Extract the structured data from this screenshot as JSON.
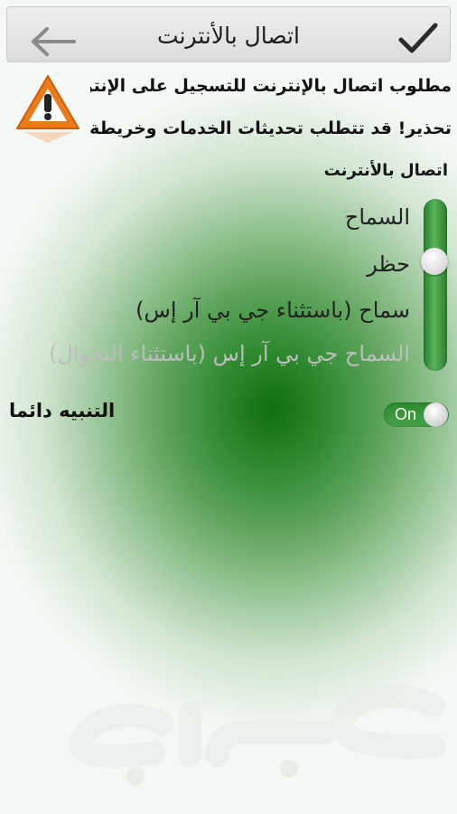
{
  "header": {
    "title": "اتصال بالأنترنت",
    "confirm_icon": "check-icon",
    "back_icon": "arrow-left-icon"
  },
  "warning": {
    "icon": "warning-triangle-icon",
    "line1": "مطلوب اتصال بالإنترنت للتسجيل على الإنترنت",
    "line2": "تحذير! قد تتطلب تحديثات الخدمات وخريطة"
  },
  "connection": {
    "label": "اتصال بالأنترنت",
    "options": [
      {
        "label": "السماح",
        "state": "active"
      },
      {
        "label": "حظر",
        "state": "active"
      },
      {
        "label": "سماح (باستثناء جي بي آر إس)",
        "state": "active"
      },
      {
        "label": "السماح جي بي آر إس (باستثناء التجوال)",
        "state": "dim"
      }
    ],
    "selected_index": 1
  },
  "always_alert": {
    "label": "التنبيه دائما",
    "toggle_text": "On",
    "enabled": true
  },
  "colors": {
    "accent": "#3a9a3c",
    "background_center": "#0f6f10"
  },
  "watermark": {
    "text": "حراج"
  }
}
